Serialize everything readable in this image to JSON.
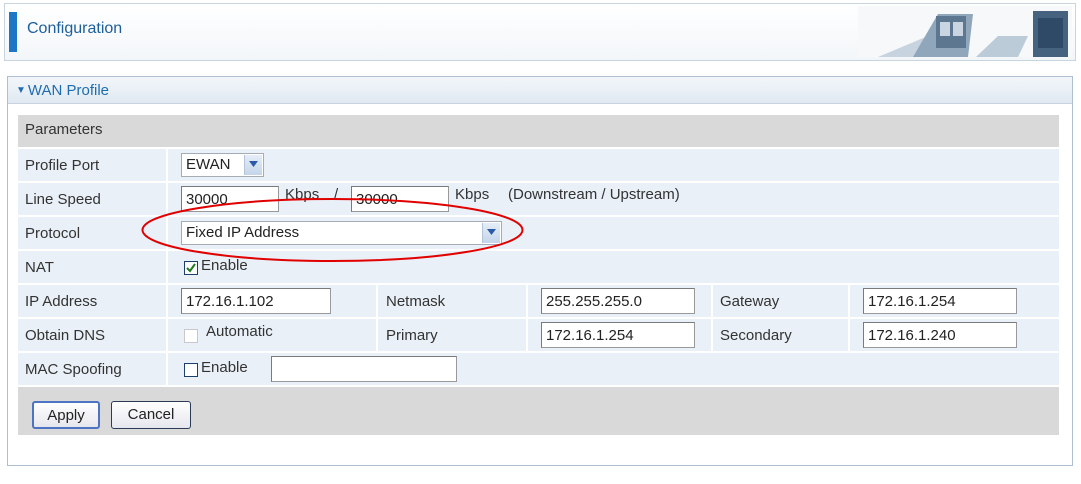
{
  "header": {
    "title": "Configuration"
  },
  "panel": {
    "title": "WAN Profile",
    "section_header": "Parameters",
    "profile_port": {
      "label": "Profile Port",
      "value": "EWAN"
    },
    "line_speed": {
      "label": "Line Speed",
      "downstream": "30000",
      "upstream": "30000",
      "unit1": "Kbps",
      "slash": "/",
      "unit2": "Kbps",
      "note": "(Downstream / Upstream)"
    },
    "protocol": {
      "label": "Protocol",
      "value": "Fixed IP Address"
    },
    "nat": {
      "label": "NAT",
      "checkbox_label": "Enable",
      "checked": true
    },
    "ip_address": {
      "label": "IP Address",
      "value": "172.16.1.102"
    },
    "netmask": {
      "label": "Netmask",
      "value": "255.255.255.0"
    },
    "gateway": {
      "label": "Gateway",
      "value": "172.16.1.254"
    },
    "obtain_dns": {
      "label": "Obtain DNS",
      "checkbox_label": "Automatic",
      "checked": false
    },
    "primary": {
      "label": "Primary",
      "value": "172.16.1.254"
    },
    "secondary": {
      "label": "Secondary",
      "value": "172.16.1.240"
    },
    "mac_spoofing": {
      "label": "MAC Spoofing",
      "checkbox_label": "Enable",
      "checked": false,
      "value": ""
    },
    "buttons": {
      "apply": "Apply",
      "cancel": "Cancel"
    }
  },
  "colors": {
    "accent": "#1d77c6",
    "row_bg": "#e9f0f7",
    "header_bg": "#d9d9d9",
    "highlight": "#e00000"
  }
}
